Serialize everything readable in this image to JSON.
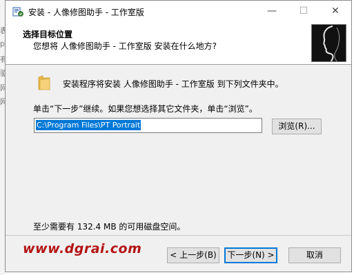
{
  "window": {
    "title": "安装 - 人像修图助手 - 工作室版",
    "minimize_glyph": "—",
    "maximize_glyph": "☐",
    "close_glyph": "✕"
  },
  "background_fragments": [
    "表",
    "p",
    "有",
    "驱",
    "网",
    "网"
  ],
  "header": {
    "title": "选择目标位置",
    "subtitle": "您想将 人像修图助手 - 工作室版 安装在什么地方?"
  },
  "body": {
    "intro": "安装程序将安装 人像修图助手 - 工作室版 到下列文件夹中。",
    "instruction": "单击“下一步”继续。如果您想选择其它文件夹，单击“浏览”。",
    "path_value": "C:\\Program Files\\PT Portrait",
    "browse_label": "浏览(R)...",
    "space_required": "至少需要有 132.4 MB 的可用磁盘空间。"
  },
  "footer": {
    "watermark": "www.dgrai.com",
    "back_label": "< 上一步(B)",
    "next_label": "下一步(N) >",
    "cancel_label": "取消"
  },
  "icons": {
    "app": "installer-icon",
    "folder": "folder-icon",
    "header_image": "portrait-silhouette-image"
  },
  "colors": {
    "accent": "#0078d7",
    "watermark": "#b31515",
    "dialog_bg": "#f0f0f0"
  }
}
